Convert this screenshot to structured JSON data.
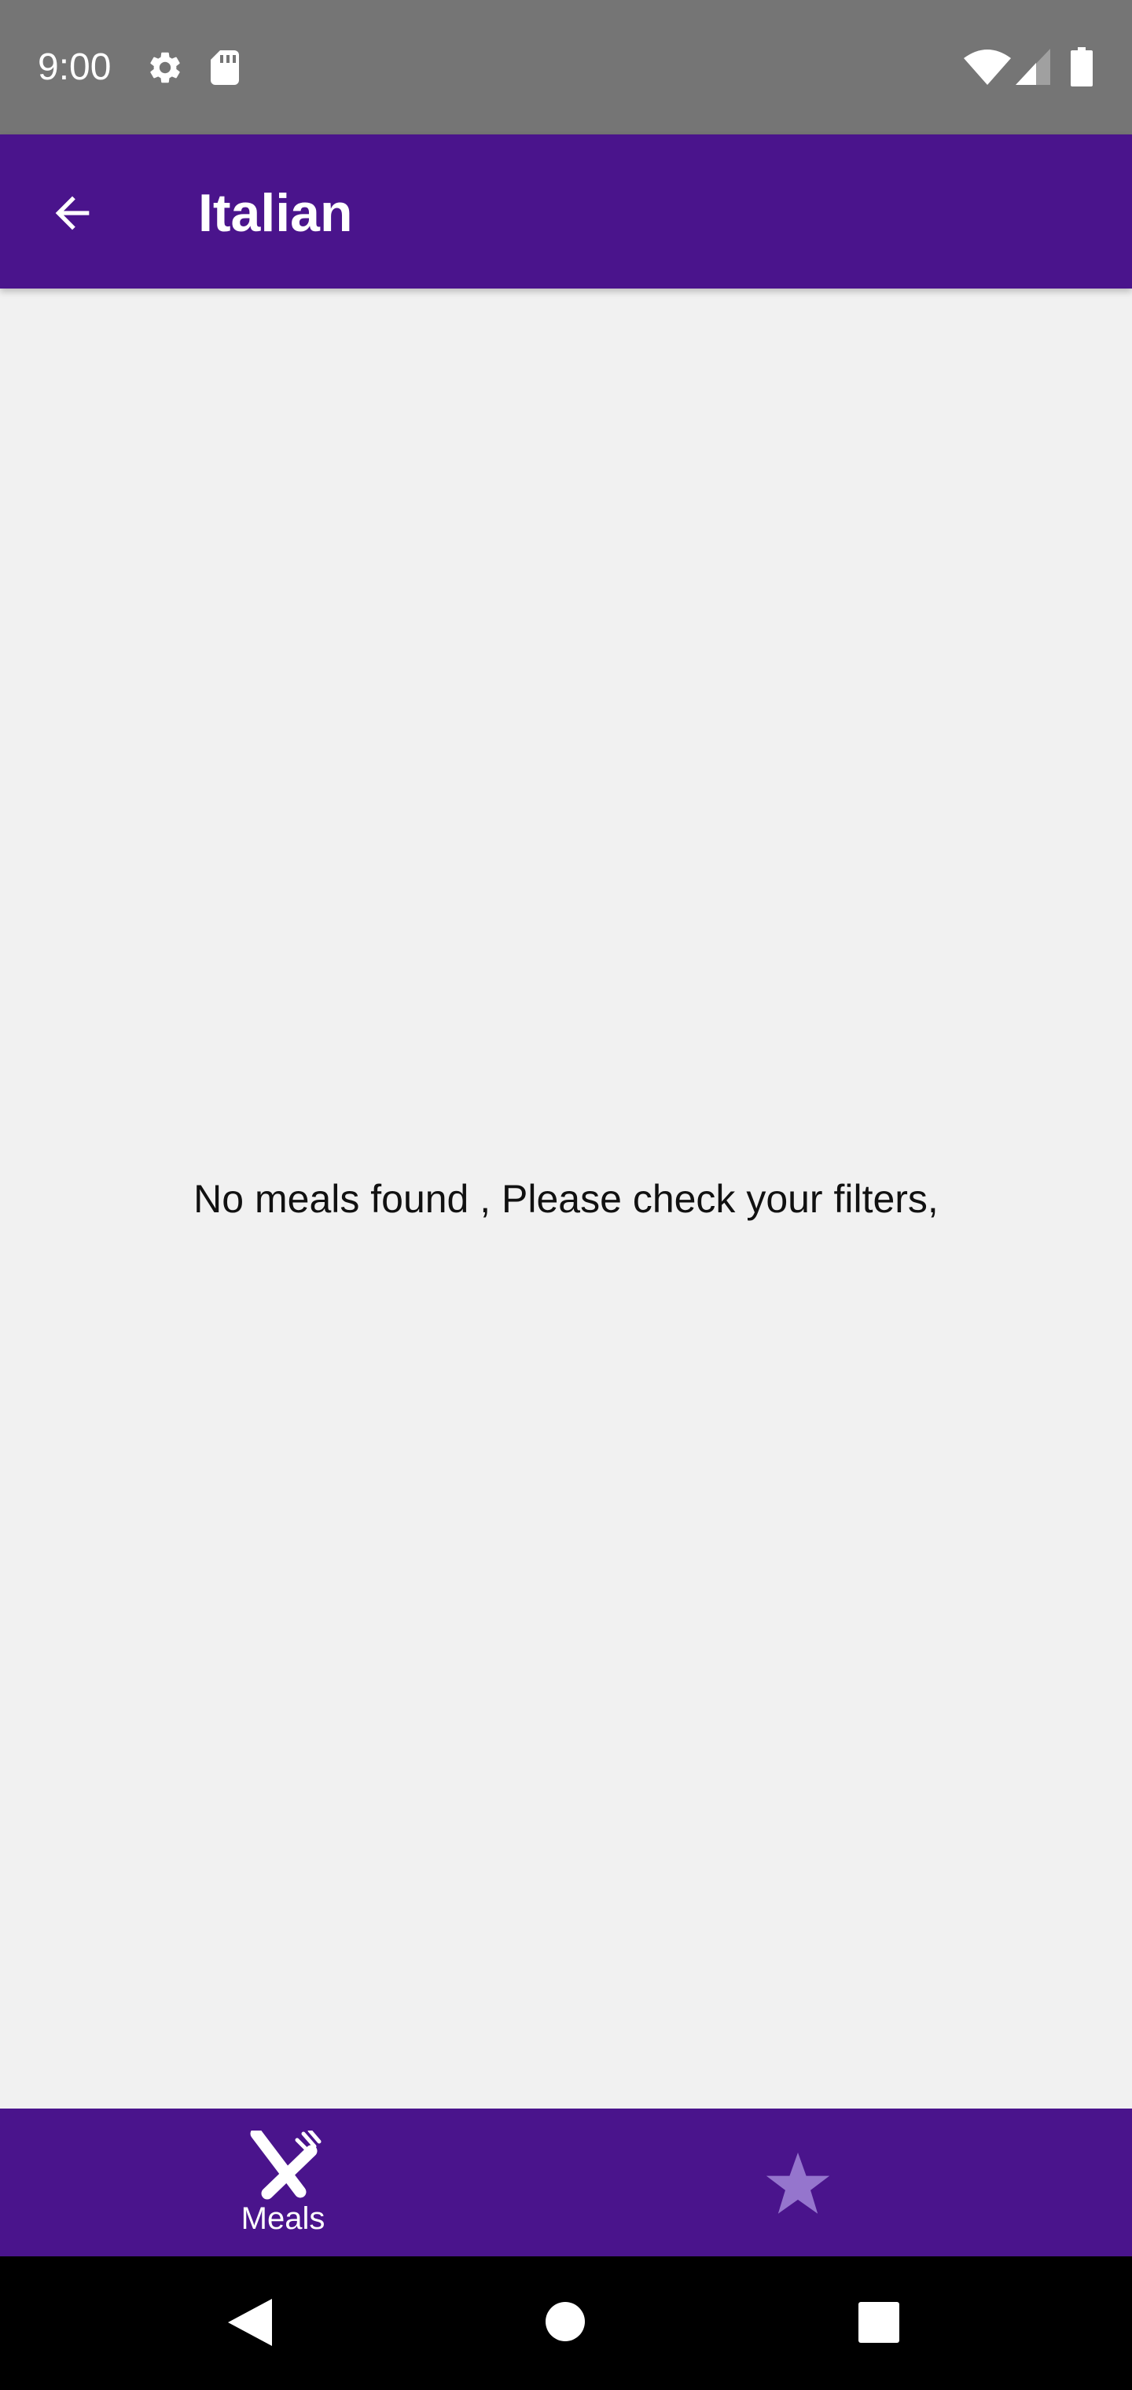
{
  "status_bar": {
    "time": "9:00",
    "icons": [
      "gear-icon",
      "sd-card-icon",
      "wifi-icon",
      "signal-icon",
      "battery-icon"
    ]
  },
  "app_bar": {
    "title": "Italian",
    "back_icon": "arrow-left-icon"
  },
  "content": {
    "empty_message": "No meals found , Please check your filters,"
  },
  "bottom_nav": {
    "items": [
      {
        "label": "Meals",
        "icon": "fork-knife-icon",
        "selected": true
      },
      {
        "label": "",
        "icon": "star-icon",
        "selected": false
      }
    ]
  },
  "system_nav": {
    "buttons": [
      "back-triangle-icon",
      "home-circle-icon",
      "recents-square-icon"
    ]
  },
  "colors": {
    "primary": "#4a148c",
    "status_bar": "#757575",
    "background": "#f1f1f1",
    "inactive_icon": "#9575cd"
  }
}
